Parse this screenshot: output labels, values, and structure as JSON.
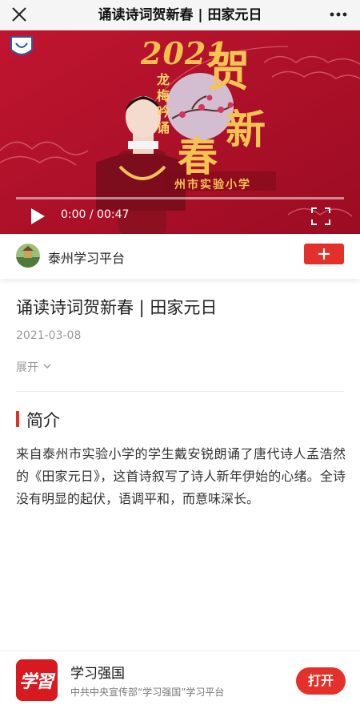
{
  "topbar": {
    "title": "诵读诗词贺新春 | 田家元日",
    "close_icon": "close-icon",
    "more_icon": "more-dots-icon"
  },
  "video": {
    "overlay": {
      "year": "2021",
      "vertical_text": "龙梅吟诵",
      "big_chars": [
        "贺",
        "新",
        "春"
      ],
      "school": "州市实验小学"
    },
    "time_display": "0:00 / 00:47",
    "progress": 0,
    "play_icon": "play-icon",
    "fullscreen_icon": "fullscreen-icon"
  },
  "channel": {
    "name": "泰州学习平台",
    "follow_icon": "plus-icon"
  },
  "article": {
    "title": "诵读诗词贺新春 | 田家元日",
    "date": "2021-03-08",
    "expand_label": "展开"
  },
  "intro": {
    "heading": "简介",
    "text": "来自泰州市实验小学的学生戴安锐朗诵了唐代诗人孟浩然的《田家元日》，这首诗叙写了诗人新年伊始的心绪。全诗没有明显的起伏，语调平和，而意味深长。"
  },
  "banner": {
    "logo_text": "学習",
    "app_name": "学习强国",
    "description": "中共中央宣传部“学习强国”学习平台",
    "open_label": "打开"
  },
  "colors": {
    "accent": "#e4302b",
    "video_bg": "#b8102a",
    "gold": "#f3c454"
  }
}
